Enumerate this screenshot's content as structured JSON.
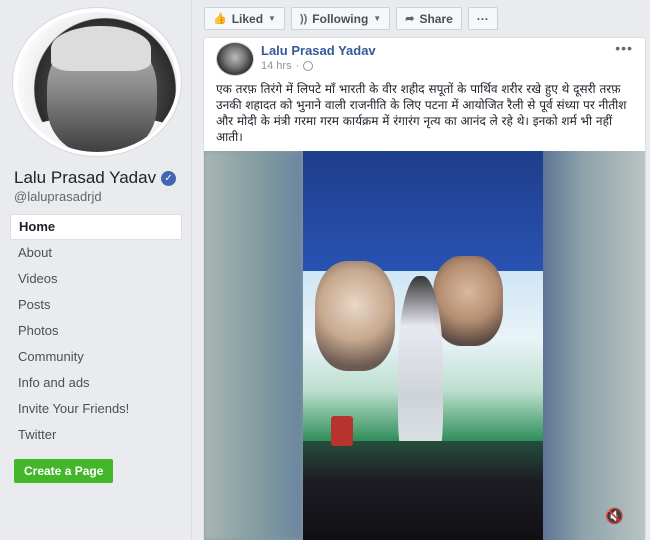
{
  "sidebar": {
    "page_name": "Lalu Prasad Yadav",
    "handle": "@laluprasadrjd",
    "nav": [
      "Home",
      "About",
      "Videos",
      "Posts",
      "Photos",
      "Community",
      "Info and ads",
      "Invite Your Friends!",
      "Twitter"
    ],
    "active_nav": "Home",
    "create_page": "Create a Page"
  },
  "actions": {
    "liked": "Liked",
    "following": "Following",
    "share": "Share",
    "more": "···"
  },
  "post": {
    "author": "Lalu Prasad Yadav",
    "time": "14 hrs",
    "more": "•••",
    "text": "एक तरफ़ तिरंगे में लिपटे माँ भारती के वीर शहीद सपूतों के पार्थिव शरीर रखे हुए थे दूसरी तरफ़ उनकी शहादत को भुनाने वाली राजनीति के लिए पटना में आयोजित रैली से पूर्व संध्या पर नीतीश और मोदी के मंत्री गरमा गरम कार्यक्रम में रंगारंग नृत्य का आनंद ले रहे थे। इनको शर्म भी नहीं आती।"
  },
  "colors": {
    "link": "#365899",
    "create_btn": "#42b72a",
    "verified": "#4267b2",
    "background": "#e9ebee"
  }
}
